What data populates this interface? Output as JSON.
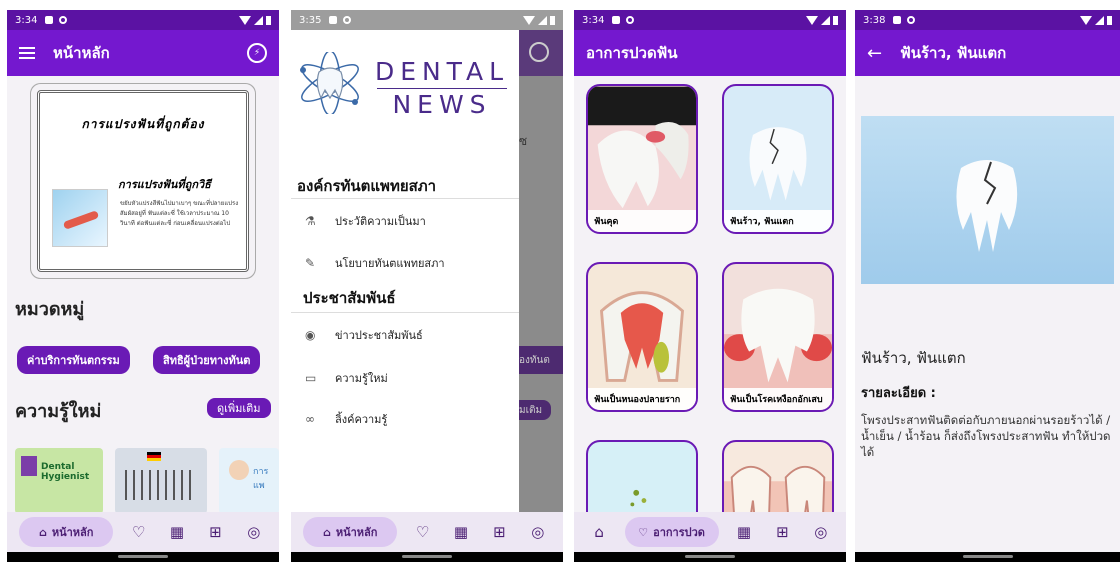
{
  "screens": {
    "home": {
      "status_time": "3:34",
      "title": "หน้าหลัก",
      "poster": {
        "title": "การแปรงฟันที่ถูกต้อง",
        "subtitle": "การแปรงฟันที่ถูกวิธี",
        "text": "ขยับหัวแปรงสีฟันไปมาเบาๆ ขณะที่ปลายแปรงสัมผัสอยู่ที่ ฟันแต่ละซี่ ใช้เวลาประมาณ 10 วินาที ต่อฟันแต่ละซี่ ก่อนเคลื่อนแปรงต่อไป"
      },
      "categories_title": "หมวดหมู่",
      "chips": [
        "ค่าบริการทันตกรรม",
        "สิทธิผู้ป่วยทางทันต"
      ],
      "knowledge_title": "ความรู้ใหม่",
      "see_more": "ดูเพิ่มเติม",
      "thumbs": [
        {
          "label": "Dental Hygienist",
          "color": "#c7e6a4"
        },
        {
          "label": "",
          "color": "#d7dde6"
        },
        {
          "label": "การแพ",
          "color": "#e5f2fa"
        }
      ],
      "nav_active": "หน้าหลัก"
    },
    "drawer": {
      "status_time": "3:35",
      "logo_line1": "DENTAL",
      "logo_line2": "NEWS",
      "group1": "องค์กรทันตแพทยสภา",
      "group1_items": [
        {
          "icon": "flask-icon",
          "glyph": "⚗",
          "label": "ประวัติความเป็นมา"
        },
        {
          "icon": "pencil-icon",
          "glyph": "✎",
          "label": "นโยบายทันตแพทยสภา"
        }
      ],
      "group2": "ประชาสัมพันธ์",
      "group2_items": [
        {
          "icon": "podcast-icon",
          "glyph": "◉",
          "label": "ข่าวประชาสัมพันธ์"
        },
        {
          "icon": "book-icon",
          "glyph": "▭",
          "label": "ความรู้ใหม่"
        },
        {
          "icon": "link-icon",
          "glyph": "∞",
          "label": "ลิ้งค์ความรู้"
        }
      ],
      "peek_chip": "องทันต",
      "peek_more": "มเติม",
      "peek_s": "ซ",
      "nav_active": "หน้าหลัก"
    },
    "symptoms": {
      "status_time": "3:34",
      "title": "อาการปวดฟัน",
      "cards": [
        {
          "label": "ฟันคุด",
          "bg": "#f3d7d8"
        },
        {
          "label": "ฟันร้าว, ฟันแตก",
          "bg": "#d7ebf8"
        },
        {
          "label": "ฟันเป็นหนองปลายราก",
          "bg": "#f5e8d9"
        },
        {
          "label": "ฟันเป็นโรคเหงือกอักเสบ",
          "bg": "#f2e0dc"
        },
        {
          "label": "",
          "bg": "#d6f0f7"
        },
        {
          "label": "",
          "bg": "#f7e9de"
        }
      ],
      "nav_active": "อาการปวด"
    },
    "detail": {
      "status_time": "3:38",
      "title": "ฟันร้าว, ฟันแตก",
      "heading": "ฟันร้าว, ฟันแตก",
      "subheading": "รายละเอียด :",
      "body": "โพรงประสาทฟันติดต่อกับภายนอกผ่านรอยร้าวได้ / น้ำเย็น / น้ำร้อน ก็ส่งถึงโพรงประสาทฟัน ทำให้ปวดได้"
    }
  },
  "colors": {
    "appbar": "#7418cf",
    "statusbar": "#5b12a3",
    "accent": "#6a1ab5",
    "nav_bg": "#ede7f3",
    "nav_active_bg": "#dcc8f1"
  }
}
